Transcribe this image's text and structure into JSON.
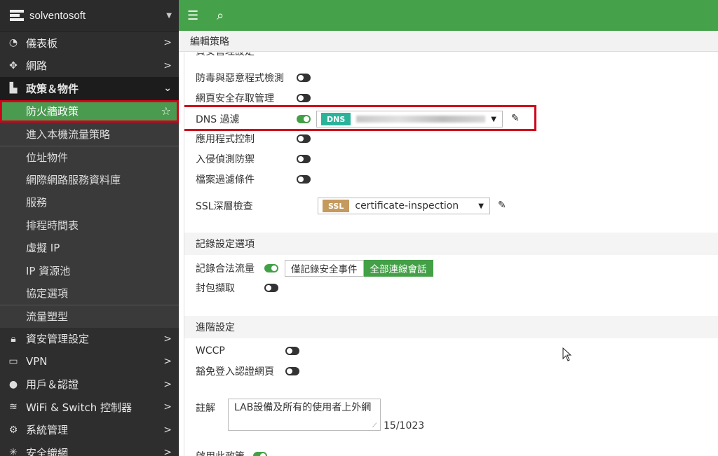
{
  "brand": {
    "name": "solventosoft"
  },
  "topbar": {
    "menu_icon": "menu-icon",
    "search_icon": "search-icon"
  },
  "page_title": "編輯策略",
  "sidebar": {
    "items": [
      {
        "label": "儀表板",
        "icon": "dashboard-icon"
      },
      {
        "label": "網路",
        "icon": "network-icon"
      },
      {
        "label": "政策＆物件",
        "icon": "policy-icon"
      },
      {
        "label": "資安管理設定",
        "icon": "lock-icon"
      },
      {
        "label": "VPN",
        "icon": "laptop-icon"
      },
      {
        "label": "用戶＆認證",
        "icon": "user-icon"
      },
      {
        "label": "WiFi & Switch 控制器",
        "icon": "wifi-icon"
      },
      {
        "label": "系統管理",
        "icon": "gear-icon"
      },
      {
        "label": "安全織網",
        "icon": "fabric-icon"
      }
    ],
    "sub_items": [
      "防火牆政策",
      "進入本機流量策略",
      "位址物件",
      "網際網路服務資料庫",
      "服務",
      "排程時間表",
      "虛擬 IP",
      "IP 資源池",
      "協定選項",
      "流量塑型"
    ]
  },
  "security": {
    "header_partial": "資安管理設定",
    "antivirus": "防毒與惡意程式檢測",
    "webfilter": "網頁安全存取管理",
    "dns": "DNS 過濾",
    "dns_tag": "DNS",
    "app_control": "應用程式控制",
    "ips": "入侵偵測防禦",
    "file_filter": "檔案過濾條件",
    "ssl": "SSL深層檢查",
    "ssl_tag": "SSL",
    "ssl_value": "certificate-inspection"
  },
  "logging": {
    "header": "記錄設定選項",
    "log_allowed": "記錄合法流量",
    "option_security": "僅記錄安全事件",
    "option_all": "全部連線會話",
    "capture": "封包擷取"
  },
  "advanced": {
    "header": "進階設定",
    "wccp": "WCCP",
    "exempt_captive": "豁免登入認證網頁",
    "comment_label": "註解",
    "comment_value": "LAB設備及所有的使用者上外網",
    "comment_count": "15/1023",
    "enable_partial": "啟用此政策"
  },
  "colors": {
    "green": "#46a24a",
    "red": "#d0021b",
    "dns_tag": "#2bb39a",
    "ssl_tag": "#c49a5e"
  }
}
